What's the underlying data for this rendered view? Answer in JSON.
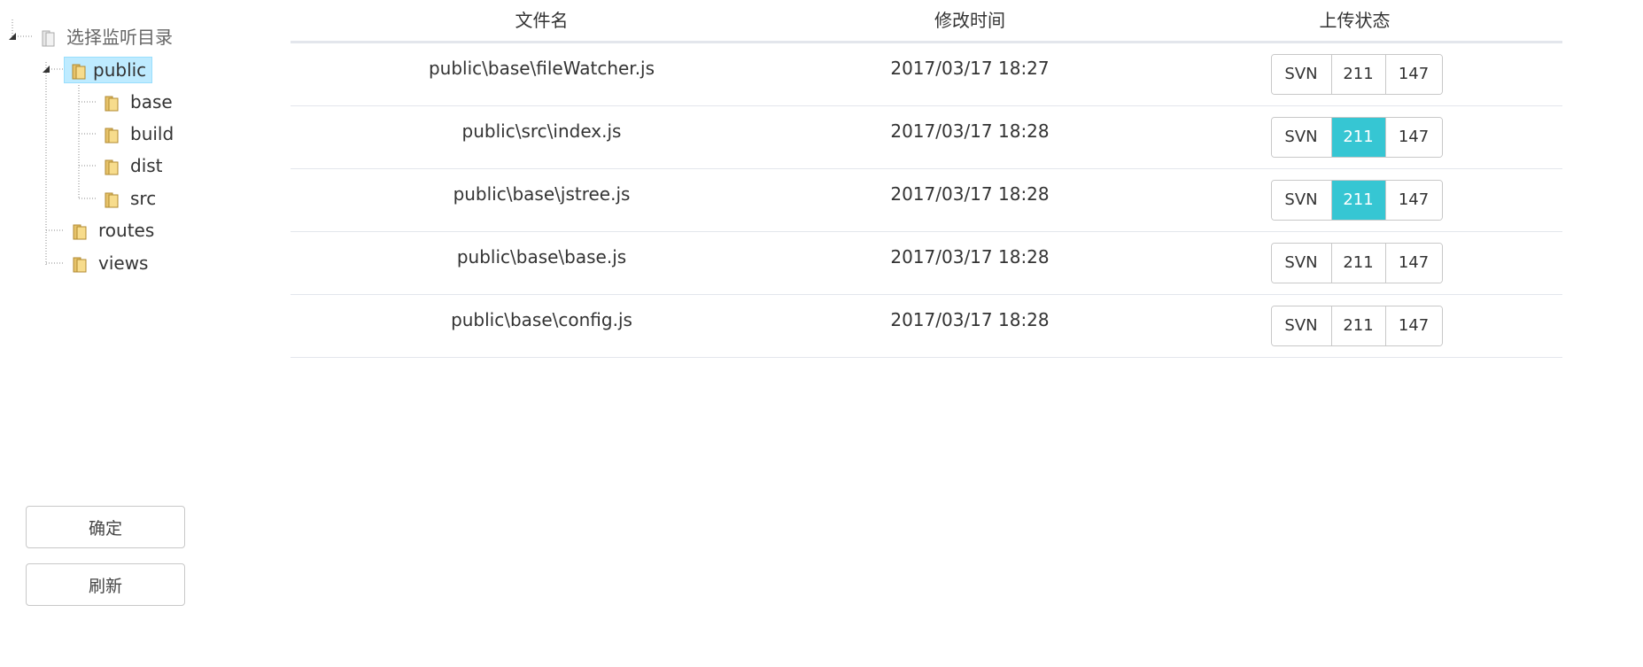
{
  "tree": {
    "root_label": "选择监听目录",
    "nodes": [
      {
        "label": "public",
        "selected": true
      },
      {
        "label": "base"
      },
      {
        "label": "build"
      },
      {
        "label": "dist"
      },
      {
        "label": "src"
      },
      {
        "label": "routes"
      },
      {
        "label": "views"
      }
    ]
  },
  "actions": {
    "confirm_label": "确定",
    "refresh_label": "刷新"
  },
  "table": {
    "headers": {
      "name": "文件名",
      "time": "修改时间",
      "status": "上传状态"
    },
    "rows": [
      {
        "name": "public\\base\\fileWatcher.js",
        "time": "2017/03/17 18:27",
        "svn": "SVN",
        "a": "211",
        "b": "147",
        "active": "none"
      },
      {
        "name": "public\\src\\index.js",
        "time": "2017/03/17 18:28",
        "svn": "SVN",
        "a": "211",
        "b": "147",
        "active": "a"
      },
      {
        "name": "public\\base\\jstree.js",
        "time": "2017/03/17 18:28",
        "svn": "SVN",
        "a": "211",
        "b": "147",
        "active": "a"
      },
      {
        "name": "public\\base\\base.js",
        "time": "2017/03/17 18:28",
        "svn": "SVN",
        "a": "211",
        "b": "147",
        "active": "none"
      },
      {
        "name": "public\\base\\config.js",
        "time": "2017/03/17 18:28",
        "svn": "SVN",
        "a": "211",
        "b": "147",
        "active": "none"
      }
    ]
  },
  "colors": {
    "active_segment": "#36c6d3",
    "selected_node_bg": "#beebff"
  }
}
